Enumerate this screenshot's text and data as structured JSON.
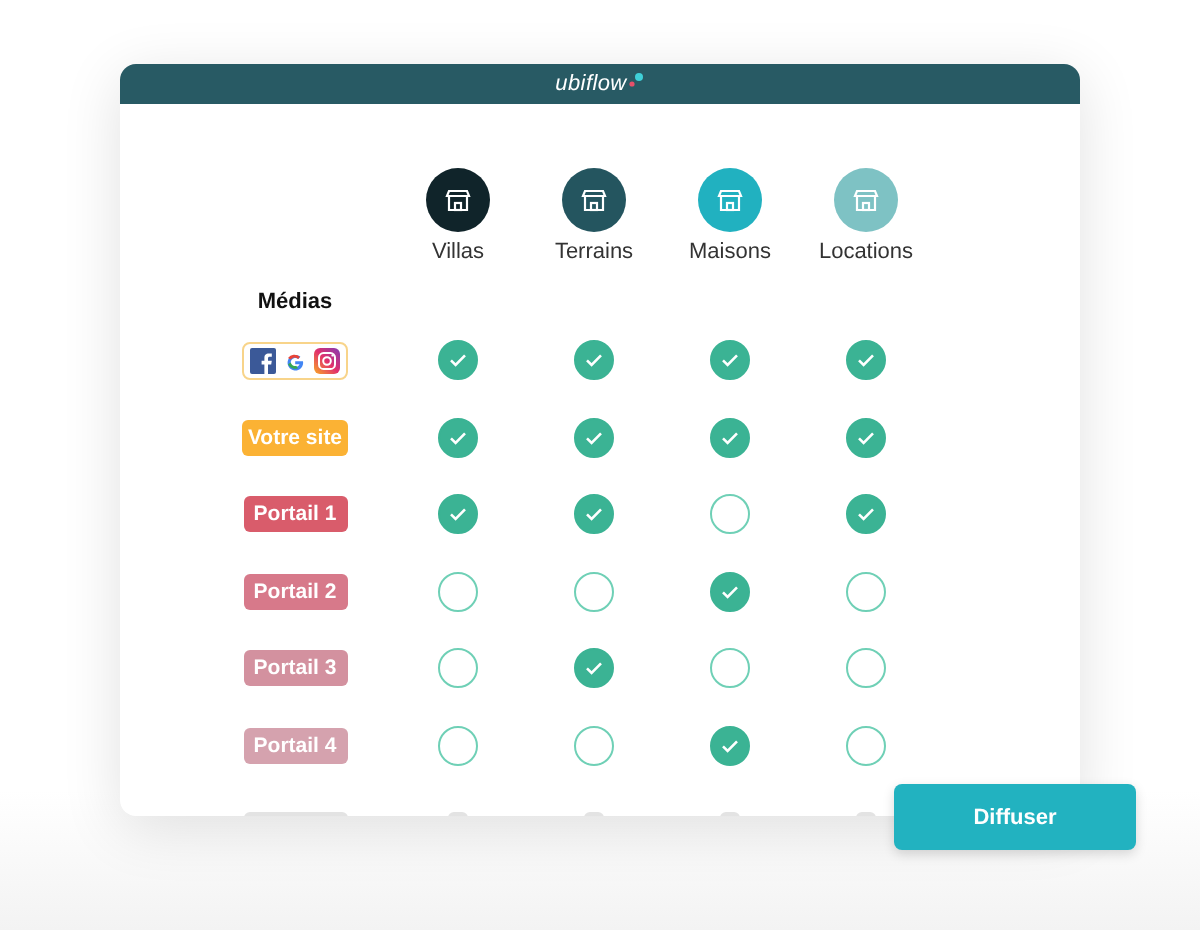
{
  "header": {
    "logo": "ubiflow"
  },
  "categories": [
    {
      "label": "Villas",
      "color": "#10242a"
    },
    {
      "label": "Terrains",
      "color": "#24555f"
    },
    {
      "label": "Maisons",
      "color": "#21b1c0"
    },
    {
      "label": "Locations",
      "color": "#7ec2c4"
    }
  ],
  "media_heading": "Médias",
  "rows": [
    {
      "kind": "social",
      "color": "#f8d48a",
      "cells": [
        {
          "checked": true
        },
        {
          "checked": true
        },
        {
          "checked": true
        },
        {
          "checked": true
        }
      ]
    },
    {
      "kind": "label",
      "label": "Votre site",
      "color": "#fbb234",
      "cells": [
        {
          "checked": true
        },
        {
          "checked": true
        },
        {
          "checked": true
        },
        {
          "checked": true
        }
      ]
    },
    {
      "kind": "label",
      "label": "Portail 1",
      "color": "#d95c6b",
      "cells": [
        {
          "checked": true
        },
        {
          "checked": true
        },
        {
          "checked": false
        },
        {
          "checked": true
        }
      ]
    },
    {
      "kind": "label",
      "label": "Portail 2",
      "color": "#d7798a",
      "cells": [
        {
          "checked": false
        },
        {
          "checked": false
        },
        {
          "checked": true
        },
        {
          "checked": false
        }
      ]
    },
    {
      "kind": "label",
      "label": "Portail 3",
      "color": "#d3919f",
      "cells": [
        {
          "checked": false
        },
        {
          "checked": true
        },
        {
          "checked": false
        },
        {
          "checked": false
        }
      ]
    },
    {
      "kind": "label",
      "label": "Portail 4",
      "color": "#d5a2ae",
      "cells": [
        {
          "checked": false
        },
        {
          "checked": false
        },
        {
          "checked": true
        },
        {
          "checked": false
        }
      ]
    },
    {
      "kind": "placeholder",
      "color": "#e3e3e3"
    }
  ],
  "button": {
    "label": "Diffuser"
  }
}
